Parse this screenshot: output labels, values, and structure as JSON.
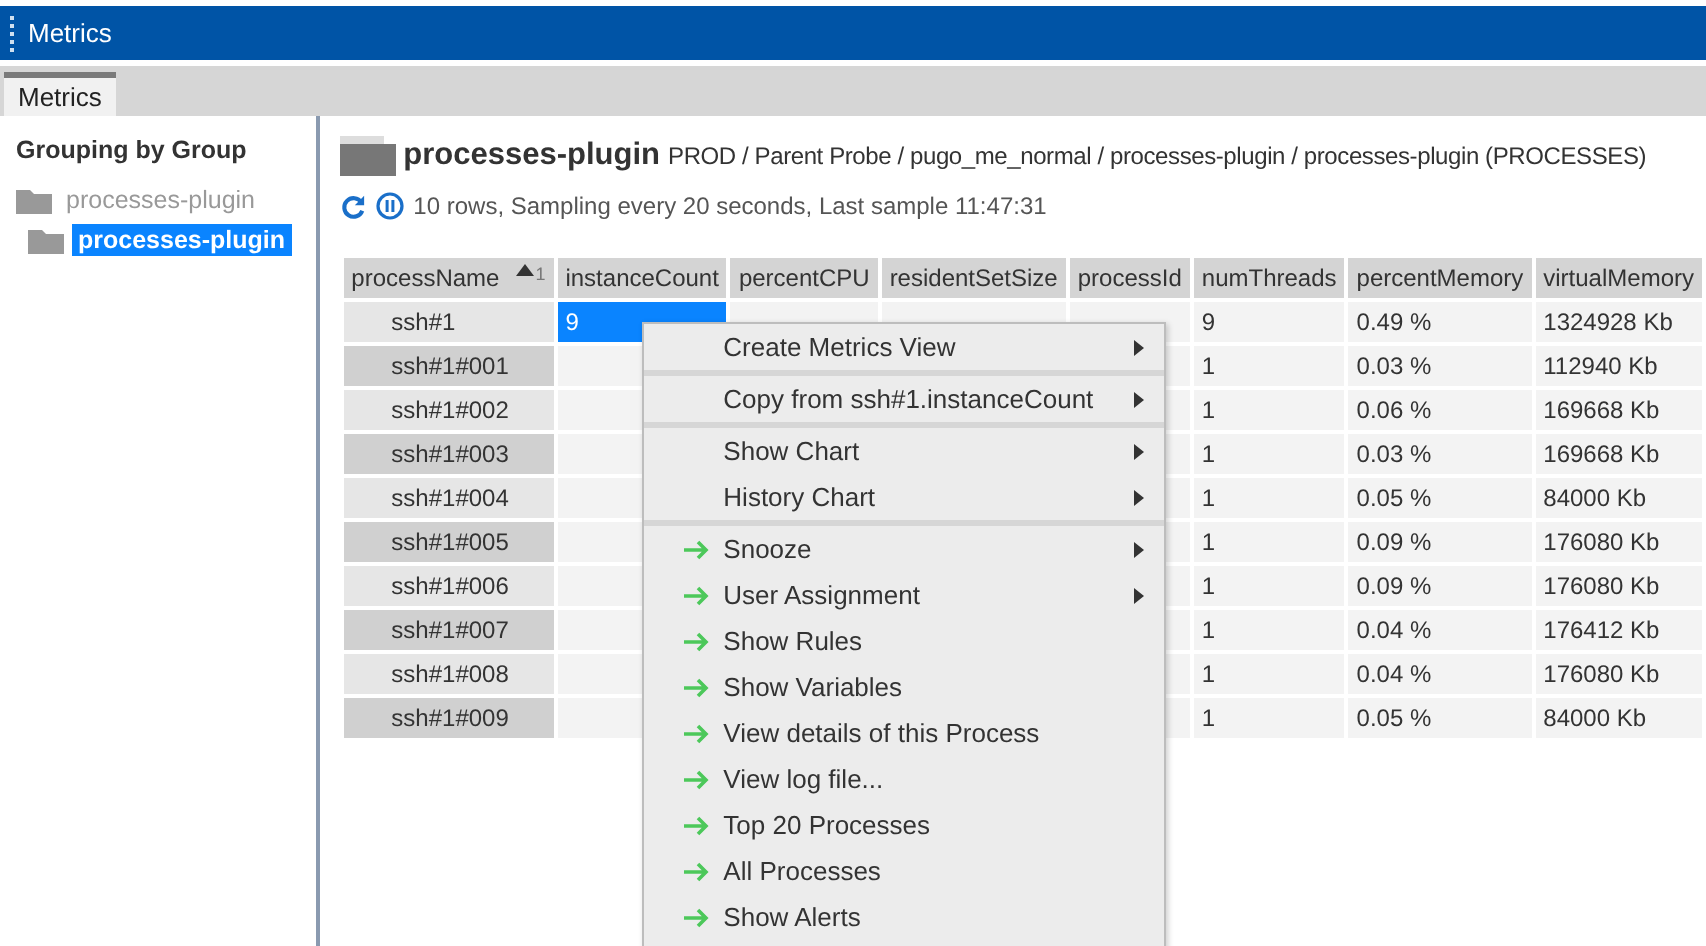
{
  "window": {
    "title": "Metrics"
  },
  "tabs": [
    {
      "label": "Metrics",
      "selected": true
    }
  ],
  "sidebar": {
    "heading": "Grouping by Group",
    "tree": [
      {
        "label": "processes-plugin",
        "selected": false,
        "children": [
          {
            "label": "processes-plugin",
            "selected": true
          }
        ]
      }
    ]
  },
  "header": {
    "title": "processes-plugin",
    "path": "PROD / Parent Probe / pugo_me_normal / processes-plugin / processes-plugin (PROCESSES)"
  },
  "status": {
    "text": "10 rows, Sampling every 20 seconds, Last sample 11:47:31"
  },
  "table": {
    "columns": [
      {
        "label": "processName",
        "sort_rank": "1"
      },
      {
        "label": "instanceCount"
      },
      {
        "label": "percentCPU"
      },
      {
        "label": "residentSetSize"
      },
      {
        "label": "processId"
      },
      {
        "label": "numThreads"
      },
      {
        "label": "percentMemory"
      },
      {
        "label": "virtualMemory"
      }
    ],
    "rows": [
      {
        "processName": "ssh#1",
        "instanceCount": "9",
        "numThreads": "9",
        "percentMemory": "0.49 %",
        "virtualMemory": "1324928 Kb",
        "selected": true
      },
      {
        "processName": "ssh#1#001",
        "numThreads": "1",
        "percentMemory": "0.03 %",
        "virtualMemory": "112940 Kb",
        "selected": false
      },
      {
        "processName": "ssh#1#002",
        "numThreads": "1",
        "percentMemory": "0.06 %",
        "virtualMemory": "169668 Kb",
        "selected": false
      },
      {
        "processName": "ssh#1#003",
        "numThreads": "1",
        "percentMemory": "0.03 %",
        "virtualMemory": "169668 Kb",
        "selected": false
      },
      {
        "processName": "ssh#1#004",
        "numThreads": "1",
        "percentMemory": "0.05 %",
        "virtualMemory": "84000 Kb",
        "selected": false
      },
      {
        "processName": "ssh#1#005",
        "numThreads": "1",
        "percentMemory": "0.09 %",
        "virtualMemory": "176080 Kb",
        "selected": false
      },
      {
        "processName": "ssh#1#006",
        "numThreads": "1",
        "percentMemory": "0.09 %",
        "virtualMemory": "176080 Kb",
        "selected": false
      },
      {
        "processName": "ssh#1#007",
        "numThreads": "1",
        "percentMemory": "0.04 %",
        "virtualMemory": "176412 Kb",
        "selected": false
      },
      {
        "processName": "ssh#1#008",
        "numThreads": "1",
        "percentMemory": "0.04 %",
        "virtualMemory": "176080 Kb",
        "selected": false
      },
      {
        "processName": "ssh#1#009",
        "numThreads": "1",
        "percentMemory": "0.05 %",
        "virtualMemory": "84000 Kb",
        "selected": false
      }
    ]
  },
  "context_menu": {
    "groups": [
      [
        {
          "label": "Create Metrics View",
          "kind": "plain",
          "submenu": true
        }
      ],
      [
        {
          "label": "Copy from ssh#1.instanceCount",
          "kind": "plain",
          "submenu": true
        }
      ],
      [
        {
          "label": "Show Chart",
          "kind": "plain",
          "submenu": true
        },
        {
          "label": "History Chart",
          "kind": "plain",
          "submenu": true
        }
      ],
      [
        {
          "label": "Snooze",
          "kind": "action",
          "submenu": true
        },
        {
          "label": "User Assignment",
          "kind": "action",
          "submenu": true
        },
        {
          "label": "Show Rules",
          "kind": "action",
          "submenu": false
        },
        {
          "label": "Show Variables",
          "kind": "action",
          "submenu": false
        },
        {
          "label": "View details of this Process",
          "kind": "action",
          "submenu": false
        },
        {
          "label": "View log file...",
          "kind": "action",
          "submenu": false
        },
        {
          "label": "Top 20 Processes",
          "kind": "action",
          "submenu": false
        },
        {
          "label": "All Processes",
          "kind": "action",
          "submenu": false
        },
        {
          "label": "Show Alerts",
          "kind": "action",
          "submenu": false
        }
      ]
    ]
  }
}
